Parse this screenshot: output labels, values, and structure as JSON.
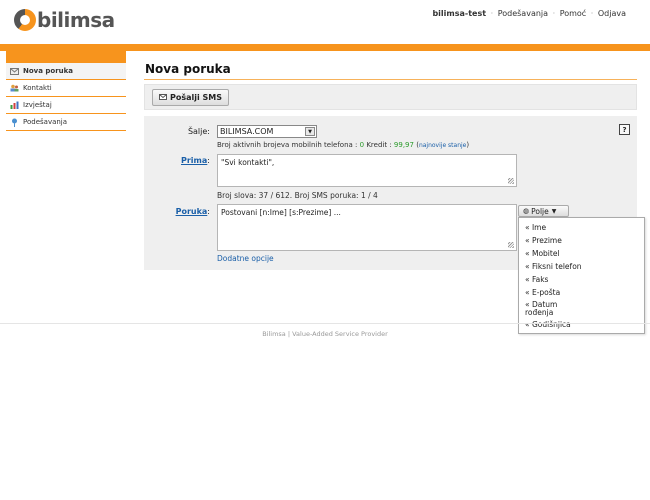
{
  "brand": {
    "logo_text": "bilimsa",
    "accent": "#f7941d"
  },
  "topnav": {
    "user": "bilimsa-test",
    "settings": "Podešavanja",
    "help": "Pomoć",
    "logout": "Odjava",
    "sep": "·"
  },
  "sidebar": {
    "items": [
      {
        "label": "Nova poruka",
        "icon": "envelope-icon"
      },
      {
        "label": "Kontakti",
        "icon": "contacts-icon"
      },
      {
        "label": "Izvještaj",
        "icon": "chart-icon"
      },
      {
        "label": "Podešavanja",
        "icon": "pin-icon"
      }
    ]
  },
  "main": {
    "title": "Nova poruka"
  },
  "toolbar": {
    "send_label": "Pošalji SMS"
  },
  "form": {
    "help": "?",
    "sender_label": "Šalje:",
    "sender_value": "BILIMSA.COM",
    "info_prefix": "Broj aktivnih brojeva mobilnih telefona :",
    "active_count": "0",
    "credit_label": "Kredit :",
    "credit_value": "99,97",
    "credit_link": "najnovije stanje",
    "recipient_label": "Prima",
    "recipient_colon": ":",
    "recipient_value": "\"Svi kontakti\",",
    "count_text": "Broj slova: 37 / 612. Broj SMS poruka: 1 / 4",
    "message_label": "Poruka",
    "message_colon": ":",
    "message_value": "Postovani [n:Ime] [s:Prezime] ...",
    "field_button": "Polje",
    "more_options": "Dodatne opcije"
  },
  "field_menu": {
    "items": [
      "« Ime",
      "« Prezime",
      "« Mobitel",
      "« Fiksni telefon",
      "« Faks",
      "« E-pošta",
      "« Datum rođenja",
      "« Godišnjica"
    ]
  },
  "footer": {
    "text": "Bilimsa | Value-Added Service Provider"
  }
}
